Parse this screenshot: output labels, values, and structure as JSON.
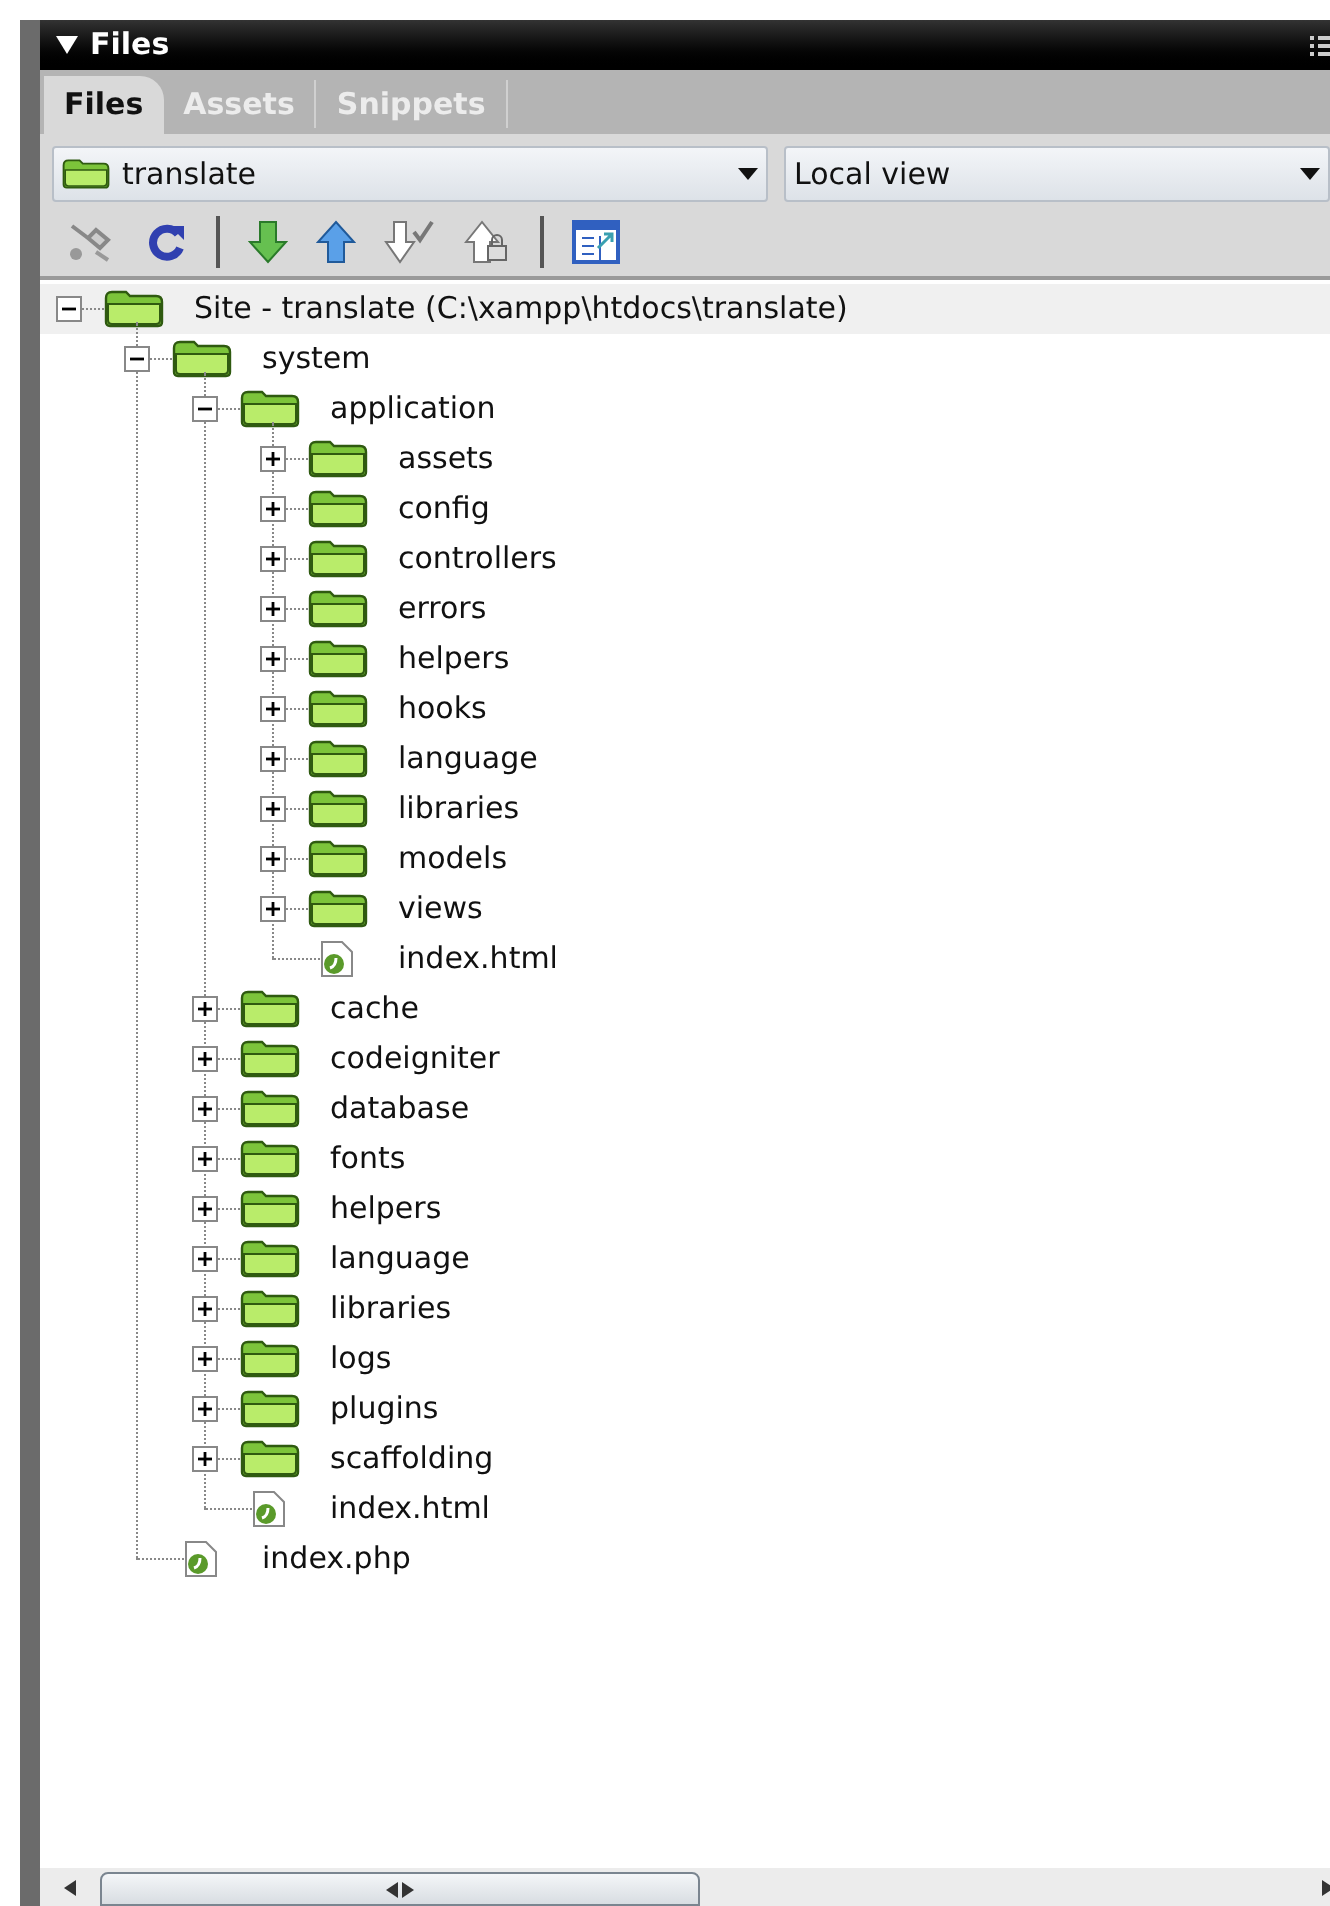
{
  "panel": {
    "title": "Files"
  },
  "tabs": [
    {
      "label": "Files",
      "selected": true
    },
    {
      "label": "Assets",
      "selected": false
    },
    {
      "label": "Snippets",
      "selected": false
    }
  ],
  "site_select": {
    "value": "translate"
  },
  "view_select": {
    "value": "Local view"
  },
  "tree": [
    {
      "label": "Site - translate (C:\\xampp\\htdocs\\translate)",
      "kind": "site",
      "expanded": true,
      "children": [
        {
          "label": "system",
          "kind": "folder",
          "expanded": true,
          "children": [
            {
              "label": "application",
              "kind": "folder",
              "expanded": true,
              "children": [
                {
                  "label": "assets",
                  "kind": "folder",
                  "expanded": false
                },
                {
                  "label": "config",
                  "kind": "folder",
                  "expanded": false
                },
                {
                  "label": "controllers",
                  "kind": "folder",
                  "expanded": false
                },
                {
                  "label": "errors",
                  "kind": "folder",
                  "expanded": false
                },
                {
                  "label": "helpers",
                  "kind": "folder",
                  "expanded": false
                },
                {
                  "label": "hooks",
                  "kind": "folder",
                  "expanded": false
                },
                {
                  "label": "language",
                  "kind": "folder",
                  "expanded": false
                },
                {
                  "label": "libraries",
                  "kind": "folder",
                  "expanded": false
                },
                {
                  "label": "models",
                  "kind": "folder",
                  "expanded": false
                },
                {
                  "label": "views",
                  "kind": "folder",
                  "expanded": false
                },
                {
                  "label": "index.html",
                  "kind": "file"
                }
              ]
            },
            {
              "label": "cache",
              "kind": "folder",
              "expanded": false
            },
            {
              "label": "codeigniter",
              "kind": "folder",
              "expanded": false
            },
            {
              "label": "database",
              "kind": "folder",
              "expanded": false
            },
            {
              "label": "fonts",
              "kind": "folder",
              "expanded": false
            },
            {
              "label": "helpers",
              "kind": "folder",
              "expanded": false
            },
            {
              "label": "language",
              "kind": "folder",
              "expanded": false
            },
            {
              "label": "libraries",
              "kind": "folder",
              "expanded": false
            },
            {
              "label": "logs",
              "kind": "folder",
              "expanded": false
            },
            {
              "label": "plugins",
              "kind": "folder",
              "expanded": false
            },
            {
              "label": "scaffolding",
              "kind": "folder",
              "expanded": false
            },
            {
              "label": "index.html",
              "kind": "file"
            }
          ]
        },
        {
          "label": "index.php",
          "kind": "file"
        }
      ]
    }
  ]
}
